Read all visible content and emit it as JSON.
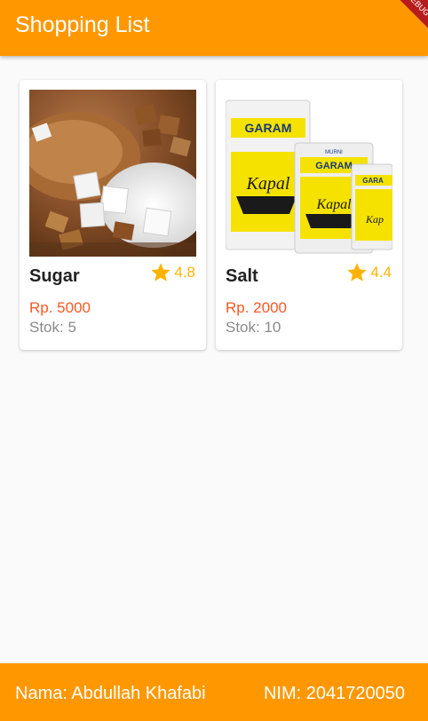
{
  "appbar": {
    "title": "Shopping List",
    "banner_text": "DEBUG"
  },
  "colors": {
    "accent": "#ff9800",
    "price": "#ff5722",
    "rating": "#ffb300",
    "stock": "#8a8a8a"
  },
  "products": [
    {
      "name": "Sugar",
      "rating": "4.8",
      "price": "Rp. 5000",
      "stock": "Stok: 5",
      "image_icon": "sugar-photo"
    },
    {
      "name": "Salt",
      "rating": "4.4",
      "price": "Rp. 2000",
      "stock": "Stok: 10",
      "image_icon": "salt-package-photo"
    }
  ],
  "footer": {
    "name": "Nama: Abdullah Khafabi",
    "nim": "NIM: 2041720050"
  }
}
